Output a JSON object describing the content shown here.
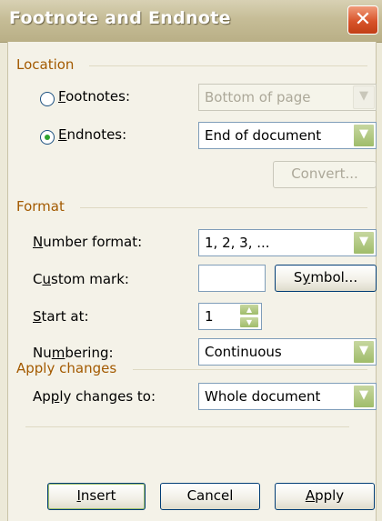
{
  "window": {
    "title": "Footnote and Endnote",
    "close_glyph": "✕"
  },
  "location": {
    "header": "Location",
    "footnotes": {
      "label": "Footnotes:",
      "accel": "F",
      "rest": "ootnotes:",
      "selected": false,
      "value": "Bottom of page"
    },
    "endnotes": {
      "label": "Endnotes:",
      "accel": "E",
      "rest": "ndnotes:",
      "selected": true,
      "value": "End of document"
    },
    "convert_label": "Convert..."
  },
  "format": {
    "header": "Format",
    "number_format": {
      "label_accel": "N",
      "label_rest": "umber format:",
      "value": "1, 2, 3, ..."
    },
    "custom_mark": {
      "label_pre": "C",
      "label_accel": "u",
      "label_rest": "stom mark:",
      "value": ""
    },
    "symbol": {
      "pre": "S",
      "accel": "y",
      "rest": "mbol..."
    },
    "start_at": {
      "label_accel": "S",
      "label_rest": "tart at:",
      "value": "1"
    },
    "numbering": {
      "label_pre": "Nu",
      "label_accel": "m",
      "label_rest": "bering:",
      "value": "Continuous"
    }
  },
  "apply_changes": {
    "header": "Apply changes",
    "apply_to": {
      "label_pre": "Ap",
      "label_accel": "p",
      "label_rest": "ly changes to:",
      "value": "Whole document"
    }
  },
  "buttons": {
    "insert": {
      "accel": "I",
      "rest": "nsert"
    },
    "cancel": "Cancel",
    "apply": {
      "accel": "A",
      "rest": "pply"
    }
  },
  "icons": {
    "arrow": "chevron-down-icon",
    "up": "spin-up-icon",
    "down": "spin-down-icon"
  }
}
